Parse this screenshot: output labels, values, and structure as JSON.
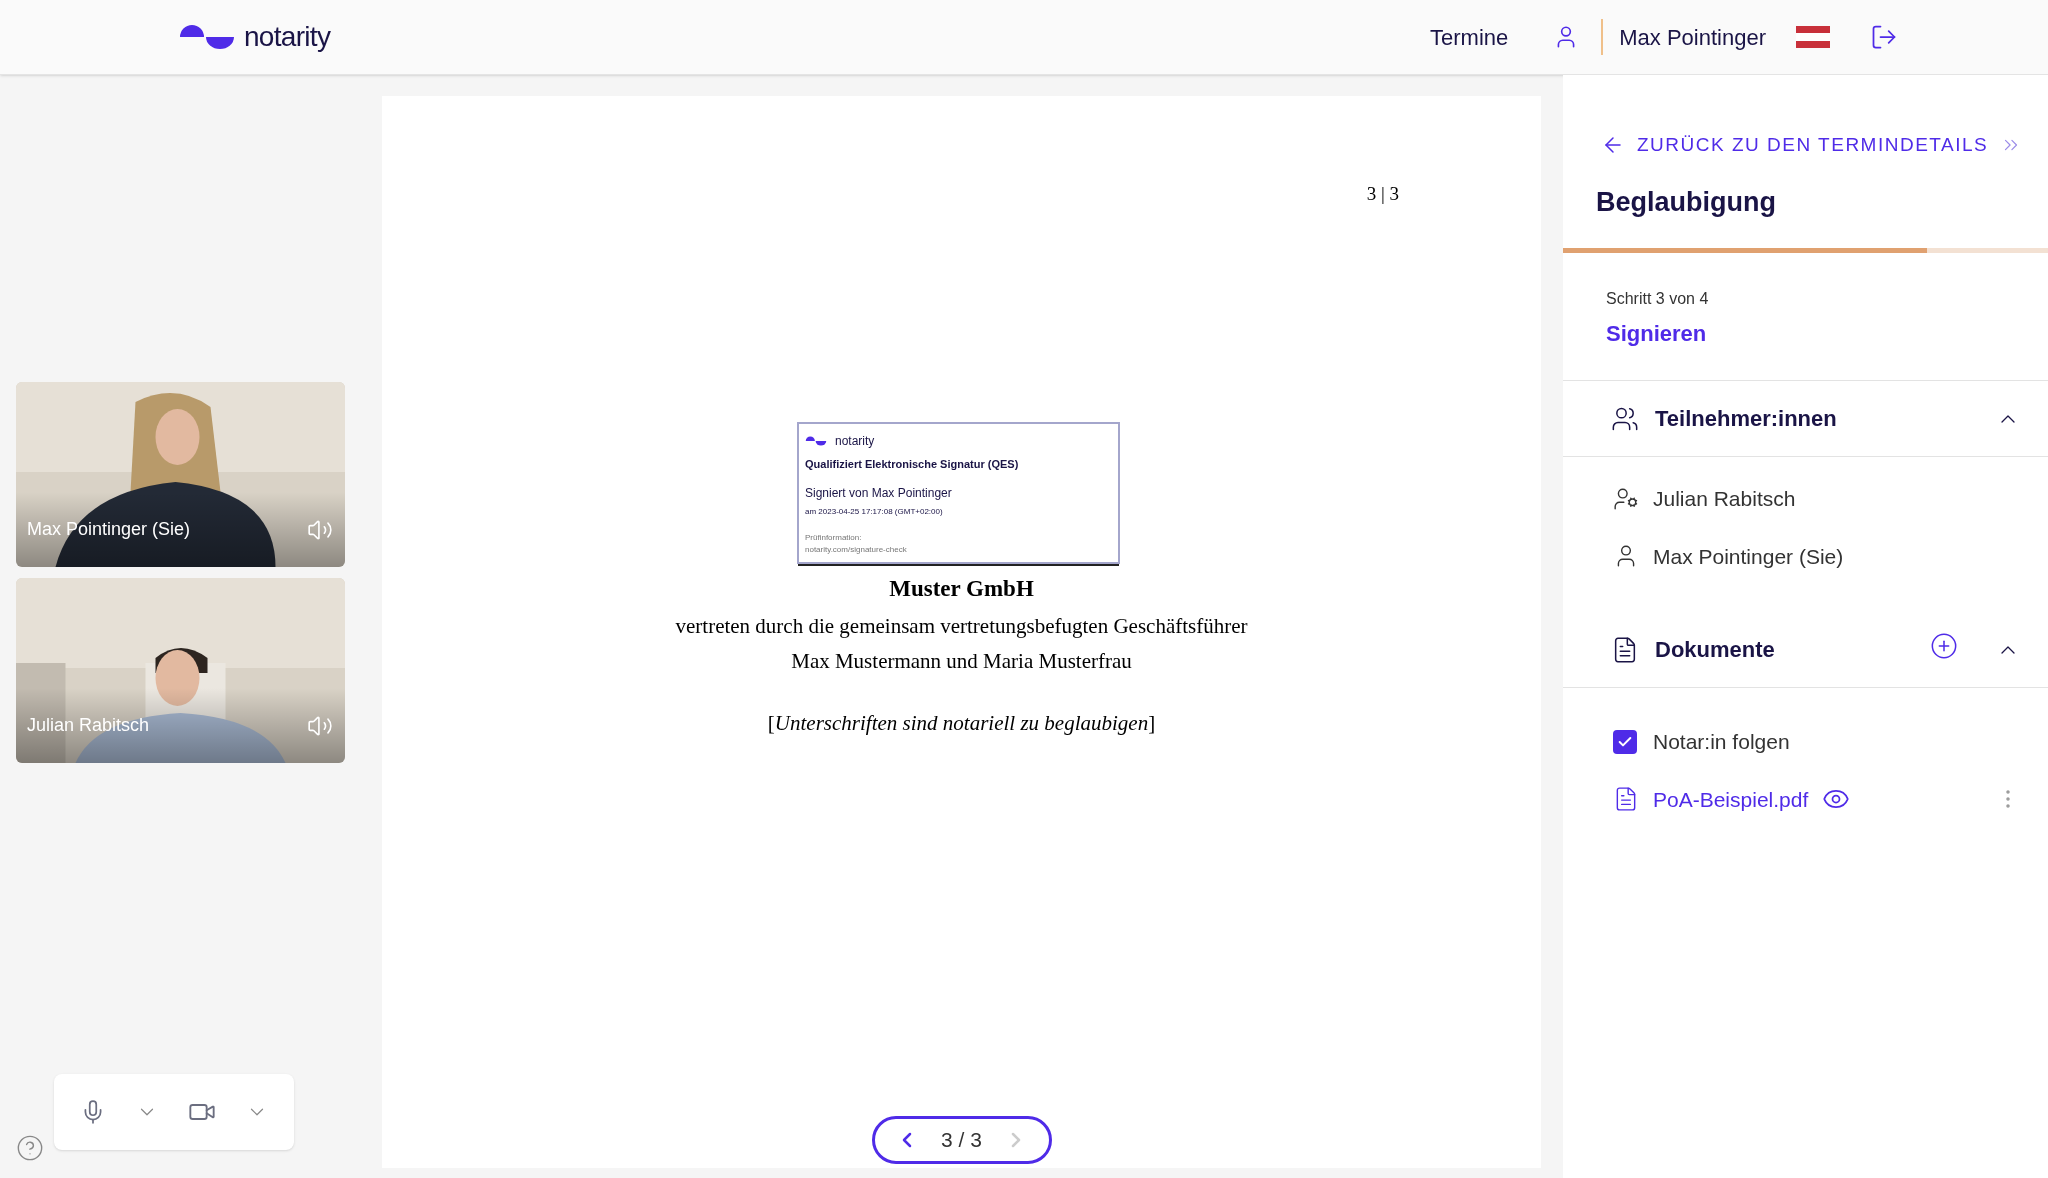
{
  "header": {
    "brand": "notarity",
    "nav_link": "Termine",
    "user_name": "Max Pointinger"
  },
  "videos": [
    {
      "name": "Max Pointinger (Sie)",
      "kind": "picture"
    },
    {
      "name": "Julian Rabitsch",
      "kind": "picture"
    }
  ],
  "document": {
    "page_marker": "3 | 3",
    "signature": {
      "brand": "notarity",
      "title": "Qualifiziert Elektronische Signatur (QES)",
      "signed_by": "Signiert von Max Pointinger",
      "date": "am 2023-04-25 17:17:08 (GMT+02:00)",
      "check_label": "Prüfinformation:",
      "check_url": "notarity.com/signature-check"
    },
    "company": "Muster GmbH",
    "line_1": "vertreten durch die gemeinsam vertretungsbefugten Geschäftsführer",
    "line_2": "Max Mustermann und Maria Musterfrau",
    "bracket_open": "[",
    "note": "Unterschriften sind notariell zu beglaubigen",
    "bracket_close": "]"
  },
  "pager": {
    "label": "3 / 3",
    "prev_disabled": false,
    "next_disabled": true
  },
  "sidebar": {
    "back_link": "ZURÜCK ZU DEN TERMINDETAILS",
    "title": "Beglaubigung",
    "progress": {
      "level": 0.75
    },
    "step": "Schritt 3 von 4",
    "step_name": "Signieren",
    "participants": {
      "title": "Teilnehmer:innen",
      "expanded": true,
      "items": [
        {
          "name": "Julian Rabitsch",
          "kind": "host"
        },
        {
          "name": "Max Pointinger (Sie)",
          "kind": "user"
        }
      ]
    },
    "documents": {
      "title": "Dokumente",
      "expanded": true,
      "follow": {
        "label": "Notar:in folgen",
        "checked": true
      },
      "files": [
        {
          "name": "PoA-Beispiel.pdf"
        }
      ]
    }
  }
}
